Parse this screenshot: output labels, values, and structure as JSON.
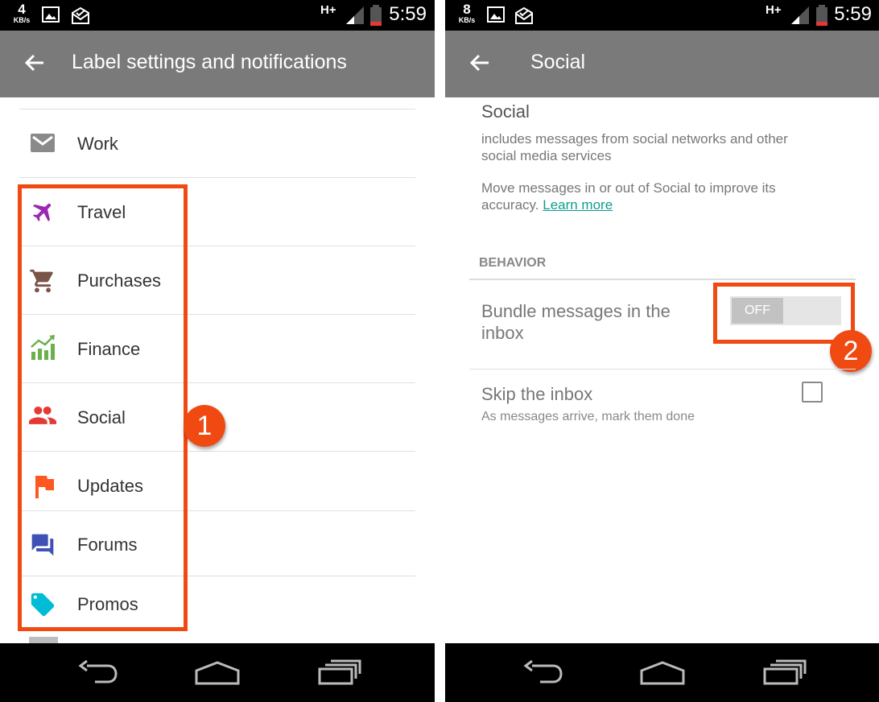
{
  "left": {
    "status": {
      "speed": "4",
      "speed_unit": "KB/s",
      "network": "H+",
      "time": "5:59"
    },
    "appbar": {
      "title": "Label settings and notifications"
    },
    "labels": [
      {
        "name": "Work",
        "icon": "inbox-icon",
        "color": "#8a8a8a"
      },
      {
        "name": "Travel",
        "icon": "airplane-icon",
        "color": "#9c27b0"
      },
      {
        "name": "Purchases",
        "icon": "cart-icon",
        "color": "#795548"
      },
      {
        "name": "Finance",
        "icon": "chart-icon",
        "color": "#6ab04c"
      },
      {
        "name": "Social",
        "icon": "people-icon",
        "color": "#e53935"
      },
      {
        "name": "Updates",
        "icon": "flag-icon",
        "color": "#ff5722"
      },
      {
        "name": "Forums",
        "icon": "forum-icon",
        "color": "#3f51b5"
      },
      {
        "name": "Promos",
        "icon": "tag-icon",
        "color": "#00bcd4"
      }
    ],
    "callout": "1"
  },
  "right": {
    "status": {
      "speed": "8",
      "speed_unit": "KB/s",
      "network": "H+",
      "time": "5:59"
    },
    "appbar": {
      "title": "Social"
    },
    "section_title": "Social",
    "description": [
      "includes messages from social networks and other",
      "social media services"
    ],
    "improve_text": [
      "Move messages in or out of Social to improve its",
      "accuracy."
    ],
    "learn_more": "Learn more",
    "behavior_header": "BEHAVIOR",
    "bundle": {
      "label": [
        "Bundle messages in the",
        "inbox"
      ],
      "toggle": "OFF"
    },
    "skip": {
      "label": "Skip the inbox",
      "sub": "As messages arrive, mark them done"
    },
    "callout": "2"
  },
  "colors": {
    "accent_red": "#f04a12",
    "appbar": "#7a7a7a",
    "link": "#0f9d8e"
  }
}
